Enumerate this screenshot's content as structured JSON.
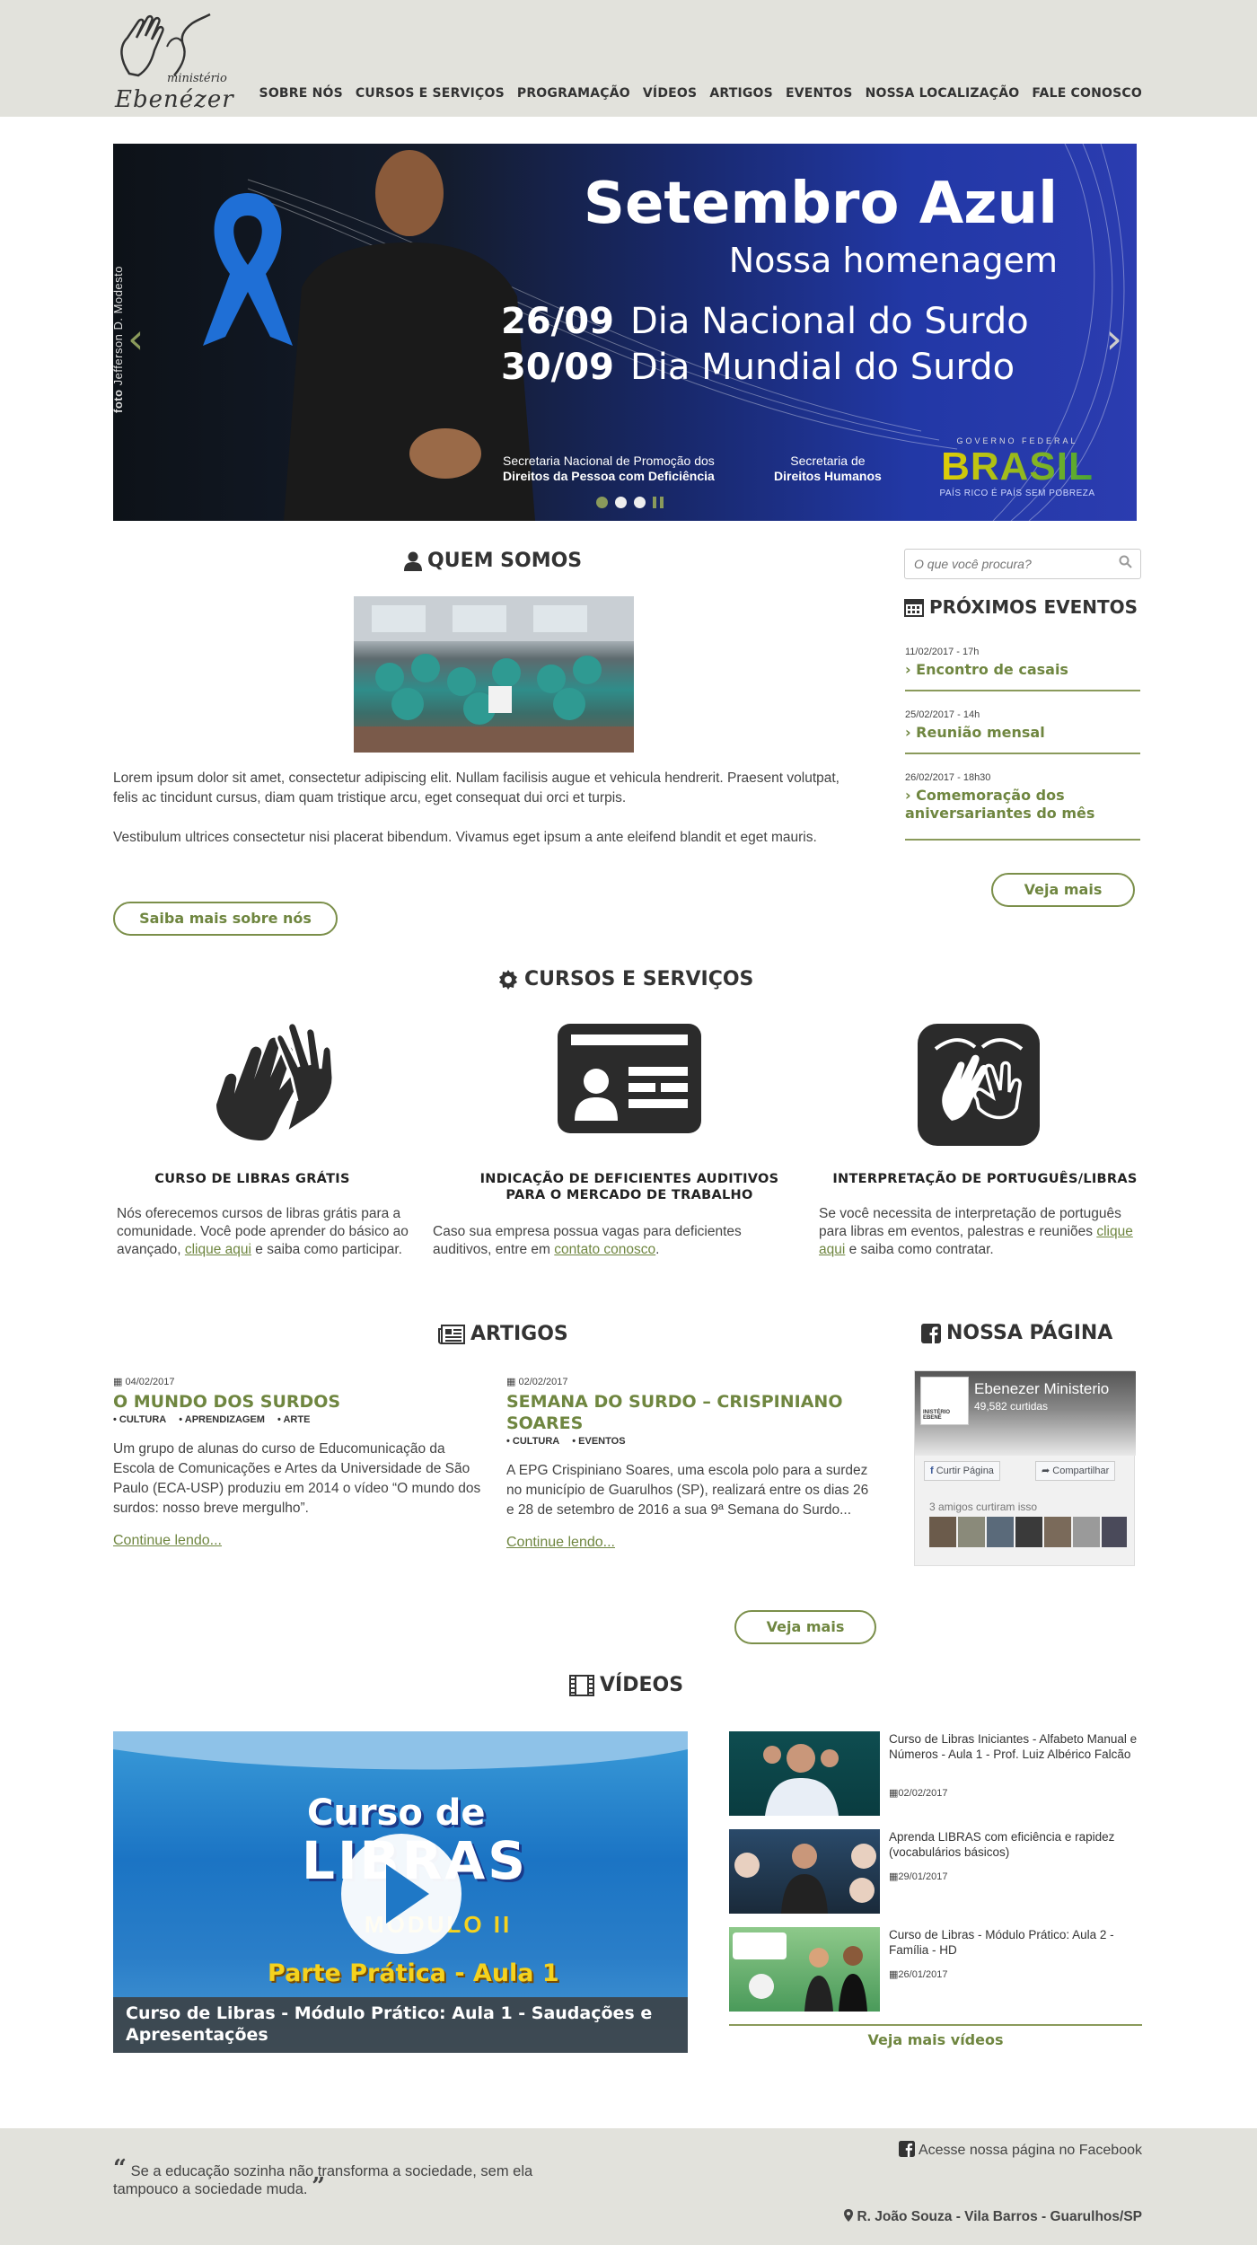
{
  "header": {
    "logo_word1": "ministério",
    "logo_word2": "Ebenézer",
    "nav": [
      "SOBRE NÓS",
      "CURSOS E SERVIÇOS",
      "PROGRAMAÇÃO",
      "VÍDEOS",
      "ARTIGOS",
      "EVENTOS",
      "NOSSA LOCALIZAÇÃO",
      "FALE CONOSCO"
    ]
  },
  "slider": {
    "credit_label": "foto",
    "credit_name": "Jefferson D. Modesto",
    "title": "Setembro Azul",
    "subtitle": "Nossa homenagem",
    "dates": [
      {
        "date": "26/09",
        "label": "Dia Nacional do Surdo"
      },
      {
        "date": "30/09",
        "label": "Dia Mundial do Surdo"
      }
    ],
    "org1_line1": "Secretaria Nacional de Promoção dos",
    "org1_line2": "Direitos da Pessoa com Deficiência",
    "org2_line1": "Secretaria de",
    "org2_line2": "Direitos Humanos",
    "gov_top": "GOVERNO FEDERAL",
    "gov_brand": "BRASIL",
    "gov_bottom": "PAÍS RICO É PAÍS SEM POBREZA",
    "prev_arrow": "‹",
    "next_arrow": "›",
    "slide_count": 3,
    "active_slide": 1,
    "accent_color": "#8a9a5b",
    "ribbon_color": "#1f6fd6"
  },
  "quem_somos": {
    "title": "QUEM SOMOS",
    "icon": "user-icon",
    "p1": "Lorem ipsum dolor sit amet, consectetur adipiscing elit. Nullam facilisis augue et vehicula hendrerit. Praesent volutpat, felis ac tincidunt cursus, diam quam tristique arcu, eget consequat dui orci et turpis.",
    "p2": "Vestibulum ultrices consectetur nisi placerat bibendum. Vivamus eget ipsum a ante eleifend blandit et eget mauris.",
    "button": "Saiba mais sobre nós"
  },
  "search": {
    "placeholder": "O que você procura?",
    "icon": "search-icon"
  },
  "eventos": {
    "title": "PRÓXIMOS EVENTOS",
    "icon": "calendar-icon",
    "items": [
      {
        "date": "11/02/2017 - 17h",
        "title": "Encontro de casais"
      },
      {
        "date": "25/02/2017 - 14h",
        "title": "Reunião mensal"
      },
      {
        "date": "26/02/2017 - 18h30",
        "title": "Comemoração dos aniversariantes do mês"
      }
    ],
    "button": "Veja mais"
  },
  "cursos": {
    "title": "CURSOS E SERVIÇOS",
    "icon": "gear-icon",
    "items": [
      {
        "title": "CURSO DE LIBRAS GRÁTIS",
        "text_before": "Nós oferecemos cursos de libras grátis para a comunidade. Você pode aprender do básico ao avançado,",
        "link": "clique aqui",
        "text_after": "e saiba como participar."
      },
      {
        "title": "INDICAÇÃO DE DEFICIENTES AUDITIVOS PARA O MERCADO DE TRABALHO",
        "text_before": "Caso sua empresa possua vagas para deficientes auditivos, entre em",
        "link": "contato conosco",
        "text_after": "."
      },
      {
        "title": "INTERPRETAÇÃO DE PORTUGUÊS/LIBRAS",
        "text_before": "Se você necessita de interpretação de português para libras em eventos, palestras e reuniões",
        "link": "clique aqui",
        "text_after": "e saiba como contratar."
      }
    ]
  },
  "artigos": {
    "title": "ARTIGOS",
    "icon": "newspaper-icon",
    "items": [
      {
        "date": "04/02/2017",
        "title": "O MUNDO DOS SURDOS",
        "tags": [
          "• CULTURA",
          "• APRENDIZAGEM",
          "• ARTE"
        ],
        "text": "Um grupo de alunas do curso de Educomunicação da Escola de Comunicações e Artes da Universidade de São Paulo (ECA-USP) produziu em 2014 o vídeo “O mundo dos surdos: nosso breve mergulho”.",
        "more": "Continue lendo..."
      },
      {
        "date": "02/02/2017",
        "title": "SEMANA DO SURDO – CRISPINIANO SOARES",
        "tags": [
          "• CULTURA",
          "• EVENTOS"
        ],
        "text": "A EPG Crispiniano Soares, uma escola polo para a surdez no município de Guarulhos (SP), realizará entre os dias 26 e 28 de setembro de 2016 a sua 9ª Semana do Surdo...",
        "more": "Continue lendo..."
      }
    ],
    "button": "Veja mais"
  },
  "facebook": {
    "title": "NOSSA PÁGINA",
    "icon": "facebook-icon",
    "page_name": "Ebenezer Ministerio",
    "likes": "49,582 curtidas",
    "avatar_text": "INISTÉRIO EBENÉ",
    "like_button": "Curtir Página",
    "share_button": "Compartilhar",
    "friends": "3 amigos curtiram isso"
  },
  "videos": {
    "title": "VÍDEOS",
    "icon": "film-icon",
    "main": {
      "thumb_line1": "Curso de",
      "thumb_line2": "LIBRAS",
      "thumb_line3": "MÓDULO II",
      "thumb_line4": "Parte Prática - Aula 1",
      "caption": "Curso de Libras - Módulo Prático: Aula 1 - Saudações e Apresentações"
    },
    "list": [
      {
        "title": "Curso de Libras Iniciantes - Alfabeto Manual e Números - Aula 1 - Prof. Luiz Albérico Falcão",
        "date": "02/02/2017"
      },
      {
        "title": "Aprenda LIBRAS com eficiência e rapidez (vocabulários básicos)",
        "date": "29/01/2017"
      },
      {
        "title": "Curso de Libras - Módulo Prático: Aula 2 - Família - HD",
        "date": "26/01/2017"
      }
    ],
    "more": "Veja mais vídeos"
  },
  "footer": {
    "quote": "Se a educação sozinha não transforma a sociedade, sem ela tampouco a sociedade muda.",
    "fb_link": "Acesse nossa página no Facebook",
    "address": "R. João Souza - Vila Barros - Guarulhos/SP"
  }
}
